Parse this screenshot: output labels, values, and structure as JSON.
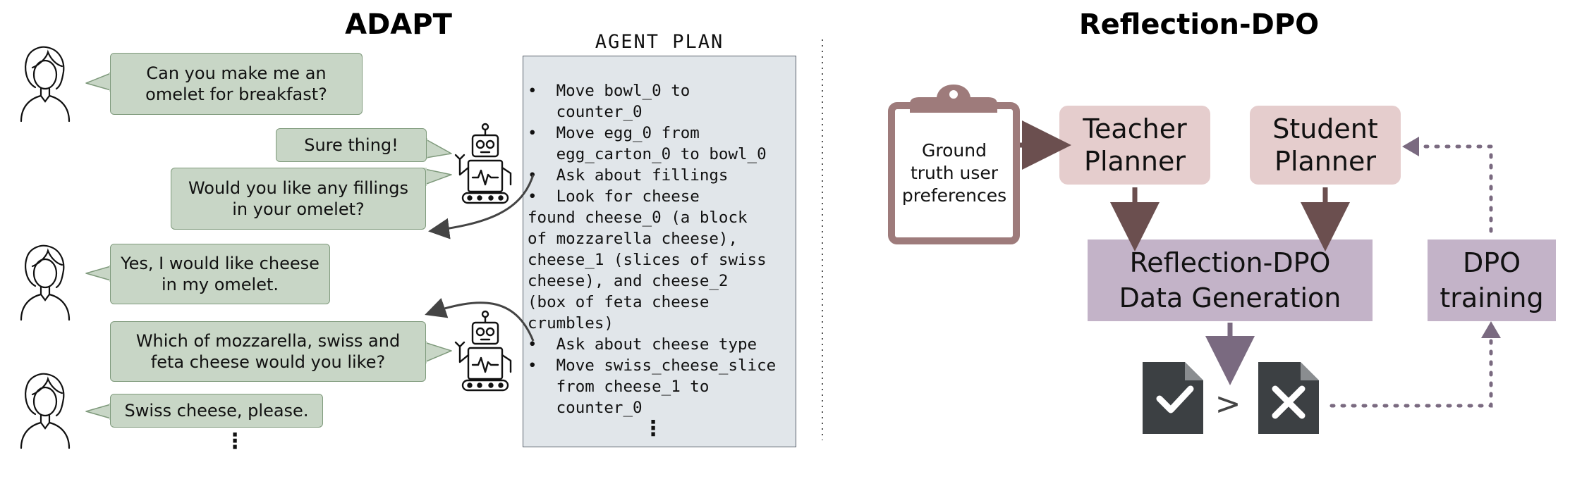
{
  "adapt": {
    "title": "ADAPT",
    "dialogue": [
      {
        "speaker": "human",
        "text": "Can you make me an omelet for breakfast?"
      },
      {
        "speaker": "robot",
        "text": "Sure thing!"
      },
      {
        "speaker": "robot",
        "text": "Would you like any fillings in your omelet?"
      },
      {
        "speaker": "human",
        "text": "Yes, I would like cheese in my omelet."
      },
      {
        "speaker": "robot",
        "text": "Which of mozzarella, swiss and feta cheese would you like?"
      },
      {
        "speaker": "human",
        "text": "Swiss cheese, please."
      }
    ],
    "dialogue_ellipsis": "⋮",
    "plan": {
      "label": "AGENT PLAN",
      "lines": [
        "•  Move bowl_0 to",
        "   counter_0",
        "•  Move egg_0 from",
        "   egg_carton_0 to bowl_0",
        "•  Ask about fillings",
        "•  Look for cheese",
        "found cheese_0 (a block",
        "of mozzarella cheese),",
        "cheese_1 (slices of swiss",
        "cheese), and cheese_2",
        "(box of feta cheese",
        "crumbles)",
        "•  Ask about cheese type",
        "•  Move swiss_cheese_slice",
        "   from cheese_1 to",
        "   counter_0"
      ],
      "ellipsis": "⋮"
    }
  },
  "reflection": {
    "title": "Reflection-DPO",
    "clipboard_text": [
      "Ground",
      "truth user",
      "preferences"
    ],
    "teacher": [
      "Teacher",
      "Planner"
    ],
    "student": [
      "Student",
      "Planner"
    ],
    "datagen": [
      "Reflection-DPO",
      "Data Generation"
    ],
    "dpo": [
      "DPO",
      "training"
    ],
    "comparison_symbol": ">",
    "colors": {
      "planner_fill": "#e5cdcd",
      "datagen_fill": "#c3b3c8",
      "brown_arrow": "#6b4f4f",
      "purple_arrow": "#7a6a80",
      "clipboard": "#9e7b7b",
      "doc": "#3c4043",
      "bubble_fill": "#c8d6c6",
      "plan_fill": "#e1e6ea"
    },
    "icons": [
      "clipboard-icon",
      "accepted-doc-icon",
      "rejected-doc-icon",
      "human-icon",
      "robot-icon"
    ]
  }
}
